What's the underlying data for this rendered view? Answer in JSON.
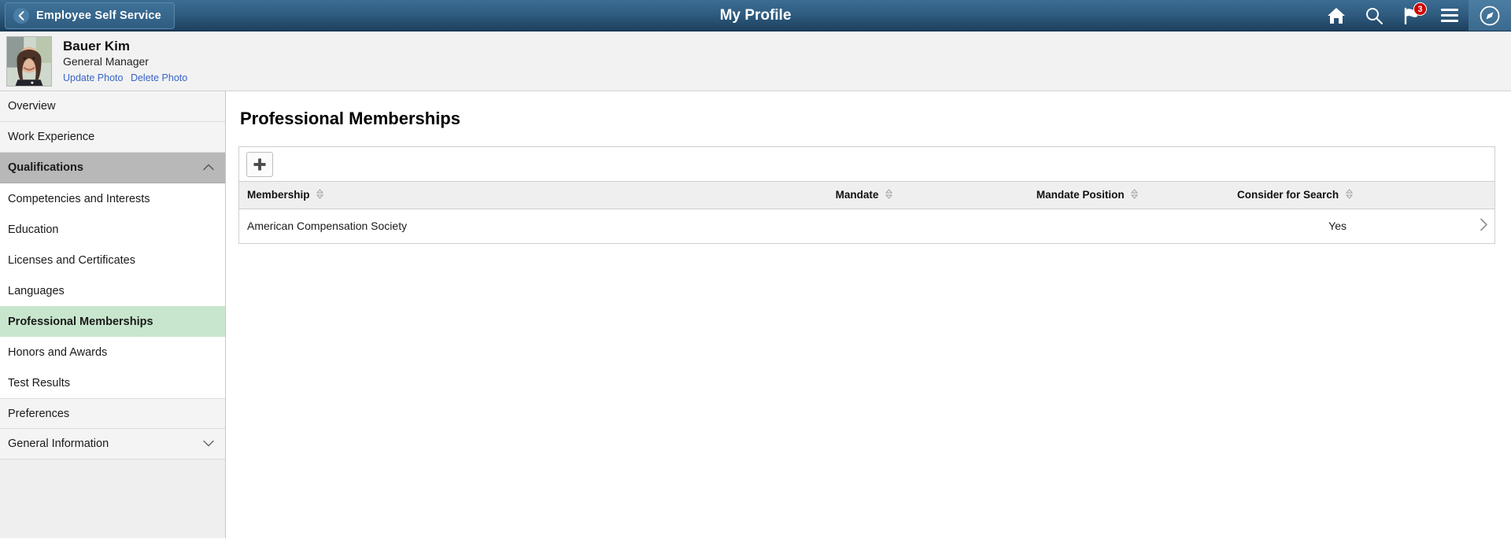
{
  "topbar": {
    "back_label": "Employee Self Service",
    "back_icon": "chevron-left-icon",
    "title": "My Profile",
    "icons": [
      {
        "name": "home-icon"
      },
      {
        "name": "search-icon"
      },
      {
        "name": "notifications-flag-icon",
        "badge": "3"
      },
      {
        "name": "actions-menu-icon"
      },
      {
        "name": "navigator-compass-icon"
      }
    ]
  },
  "profile": {
    "name": "Bauer Kim",
    "role": "General Manager",
    "update_photo": "Update Photo",
    "delete_photo": "Delete Photo"
  },
  "sidebar": {
    "items": [
      {
        "label": "Overview",
        "type": "item",
        "selected": false
      },
      {
        "label": "Work Experience",
        "type": "item",
        "selected": false
      },
      {
        "label": "Qualifications",
        "type": "group",
        "selected": false,
        "expanded": true
      },
      {
        "label": "Competencies and Interests",
        "type": "sub",
        "selected": false
      },
      {
        "label": "Education",
        "type": "sub",
        "selected": false
      },
      {
        "label": "Licenses and Certificates",
        "type": "sub",
        "selected": false
      },
      {
        "label": "Languages",
        "type": "sub",
        "selected": false
      },
      {
        "label": "Professional Memberships",
        "type": "sub",
        "selected": true
      },
      {
        "label": "Honors and Awards",
        "type": "sub",
        "selected": false
      },
      {
        "label": "Test Results",
        "type": "sub",
        "selected": false
      },
      {
        "label": "Preferences",
        "type": "item",
        "selected": false
      },
      {
        "label": "General Information",
        "type": "group-collapsed",
        "selected": false,
        "expanded": false
      }
    ]
  },
  "main": {
    "page_title": "Professional Memberships",
    "add_button_label": "+",
    "table": {
      "columns": [
        {
          "label": "Membership",
          "sortable": true
        },
        {
          "label": "Mandate",
          "sortable": true
        },
        {
          "label": "Mandate Position",
          "sortable": true
        },
        {
          "label": "Consider for Search",
          "sortable": true
        }
      ],
      "rows": [
        {
          "membership": "American Compensation Society",
          "mandate": "",
          "mandate_position": "",
          "consider_for_search": "Yes"
        }
      ]
    }
  },
  "colors": {
    "topbar_dark": "#1d3f5c",
    "topbar_light": "#3c6d93",
    "selected_nav": "#c8e6cd",
    "group_nav": "#b8b8b8",
    "badge_red": "#cc0000",
    "link_blue": "#3a64c8"
  }
}
